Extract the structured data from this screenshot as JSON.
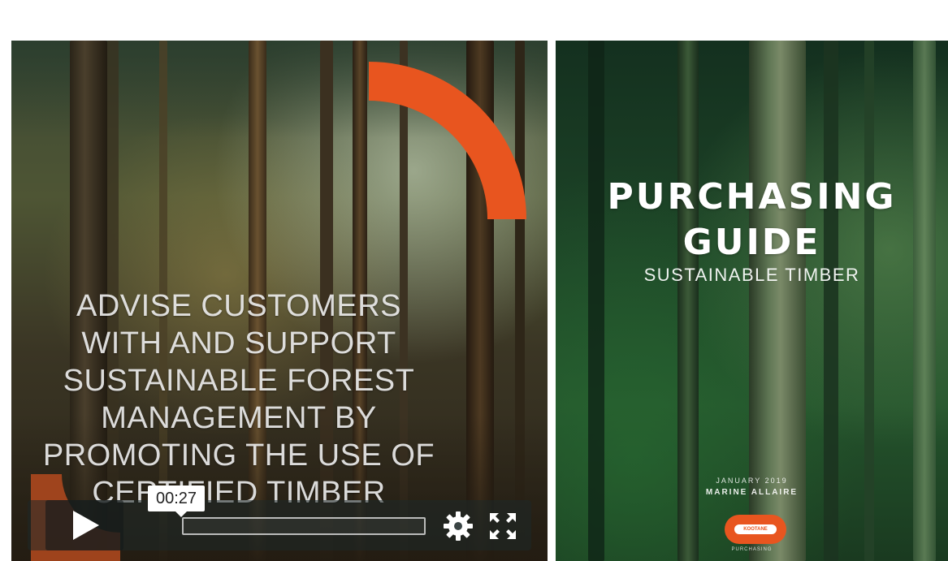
{
  "video": {
    "overlay_text": "ADVISE CUSTOMERS\nWITH AND SUPPORT\nSUSTAINABLE FOREST\nMANAGEMENT BY\nPROMOTING THE USE OF\nCERTIFIED TIMBER",
    "current_time": "00:27",
    "progress": 0.0,
    "accent_color": "#e8551f",
    "icons": {
      "play": "play-icon",
      "settings": "gear-icon",
      "fullscreen": "fullscreen-icon"
    }
  },
  "cover": {
    "title_line1": "PURCHASING",
    "title_line2": "GUIDE",
    "subtitle": "SUSTAINABLE TIMBER",
    "date": "JANUARY 2019",
    "author": "MARINE ALLAIRE",
    "logo_text": "KOOTANE",
    "logo_caption": "PURCHASING",
    "accent_color": "#e8551f"
  }
}
